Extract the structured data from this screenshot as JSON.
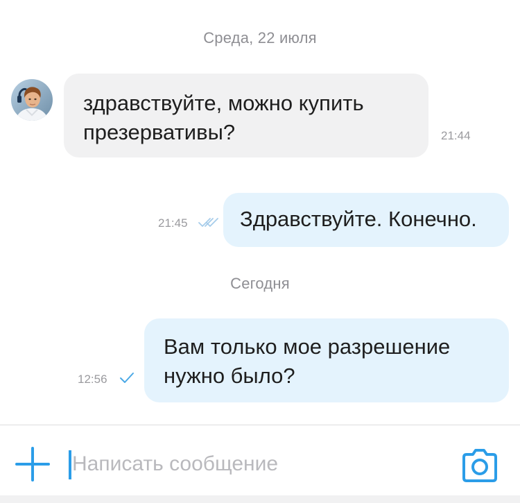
{
  "conversation": {
    "separators": [
      "Среда, 22 июля",
      "Сегодня"
    ],
    "messages": [
      {
        "direction": "incoming",
        "text_lines": [
          "здравствуйте, можно купить",
          "презервативы?"
        ],
        "time": "21:44"
      },
      {
        "direction": "outgoing",
        "text_lines": [
          "Здравствуйте. Конечно."
        ],
        "time": "21:45",
        "status": "read"
      },
      {
        "direction": "outgoing",
        "text_lines": [
          "Вам только мое разрешение",
          "нужно было?"
        ],
        "time": "12:56",
        "status": "sent"
      }
    ]
  },
  "composer": {
    "placeholder": "Написать сообщение",
    "value": "",
    "attach_icon": "plus-icon",
    "camera_icon": "camera-icon"
  },
  "colors": {
    "accent": "#2b9de8",
    "incoming_bubble": "#f1f1f2",
    "outgoing_bubble": "#e4f3fd",
    "meta_text": "#9a9a9e"
  }
}
